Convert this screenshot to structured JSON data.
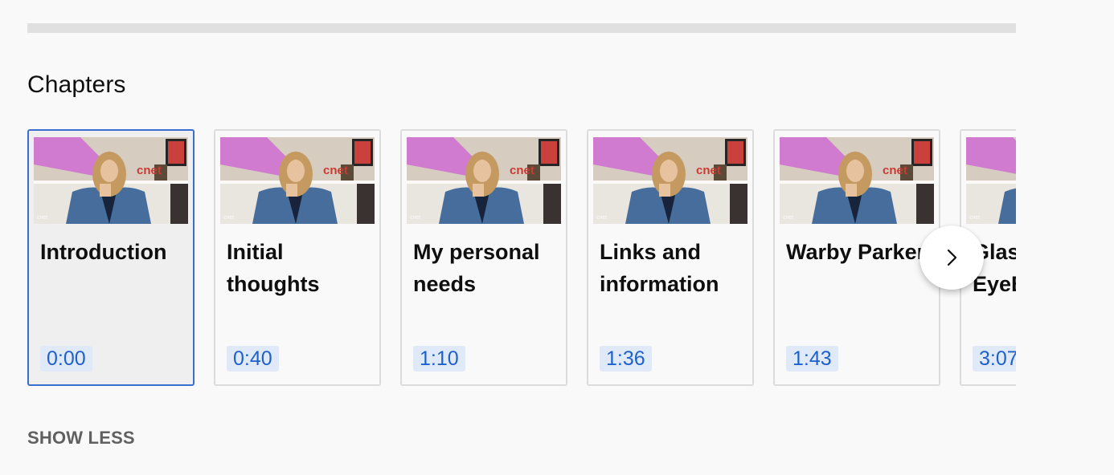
{
  "section": {
    "title": "Chapters"
  },
  "chapters": [
    {
      "title": "Introduction",
      "time": "0:00",
      "active": true
    },
    {
      "title": "Initial thoughts",
      "time": "0:40",
      "active": false
    },
    {
      "title": "My personal needs",
      "time": "1:10",
      "active": false
    },
    {
      "title": "Links and information",
      "time": "1:36",
      "active": false
    },
    {
      "title": "Warby Parker",
      "time": "1:43",
      "active": false
    },
    {
      "title": "Glasses and EyeBuyDirect",
      "time": "3:07",
      "active": false
    }
  ],
  "thumbnail": {
    "logo_text": "cnet",
    "watermark": "cnet"
  },
  "controls": {
    "next_icon": "chevron-right-icon",
    "show_less_label": "SHOW LESS"
  },
  "colors": {
    "active_border": "#3a6fd0",
    "timestamp_bg": "#dfe9f7",
    "timestamp_text": "#1e61c8"
  }
}
